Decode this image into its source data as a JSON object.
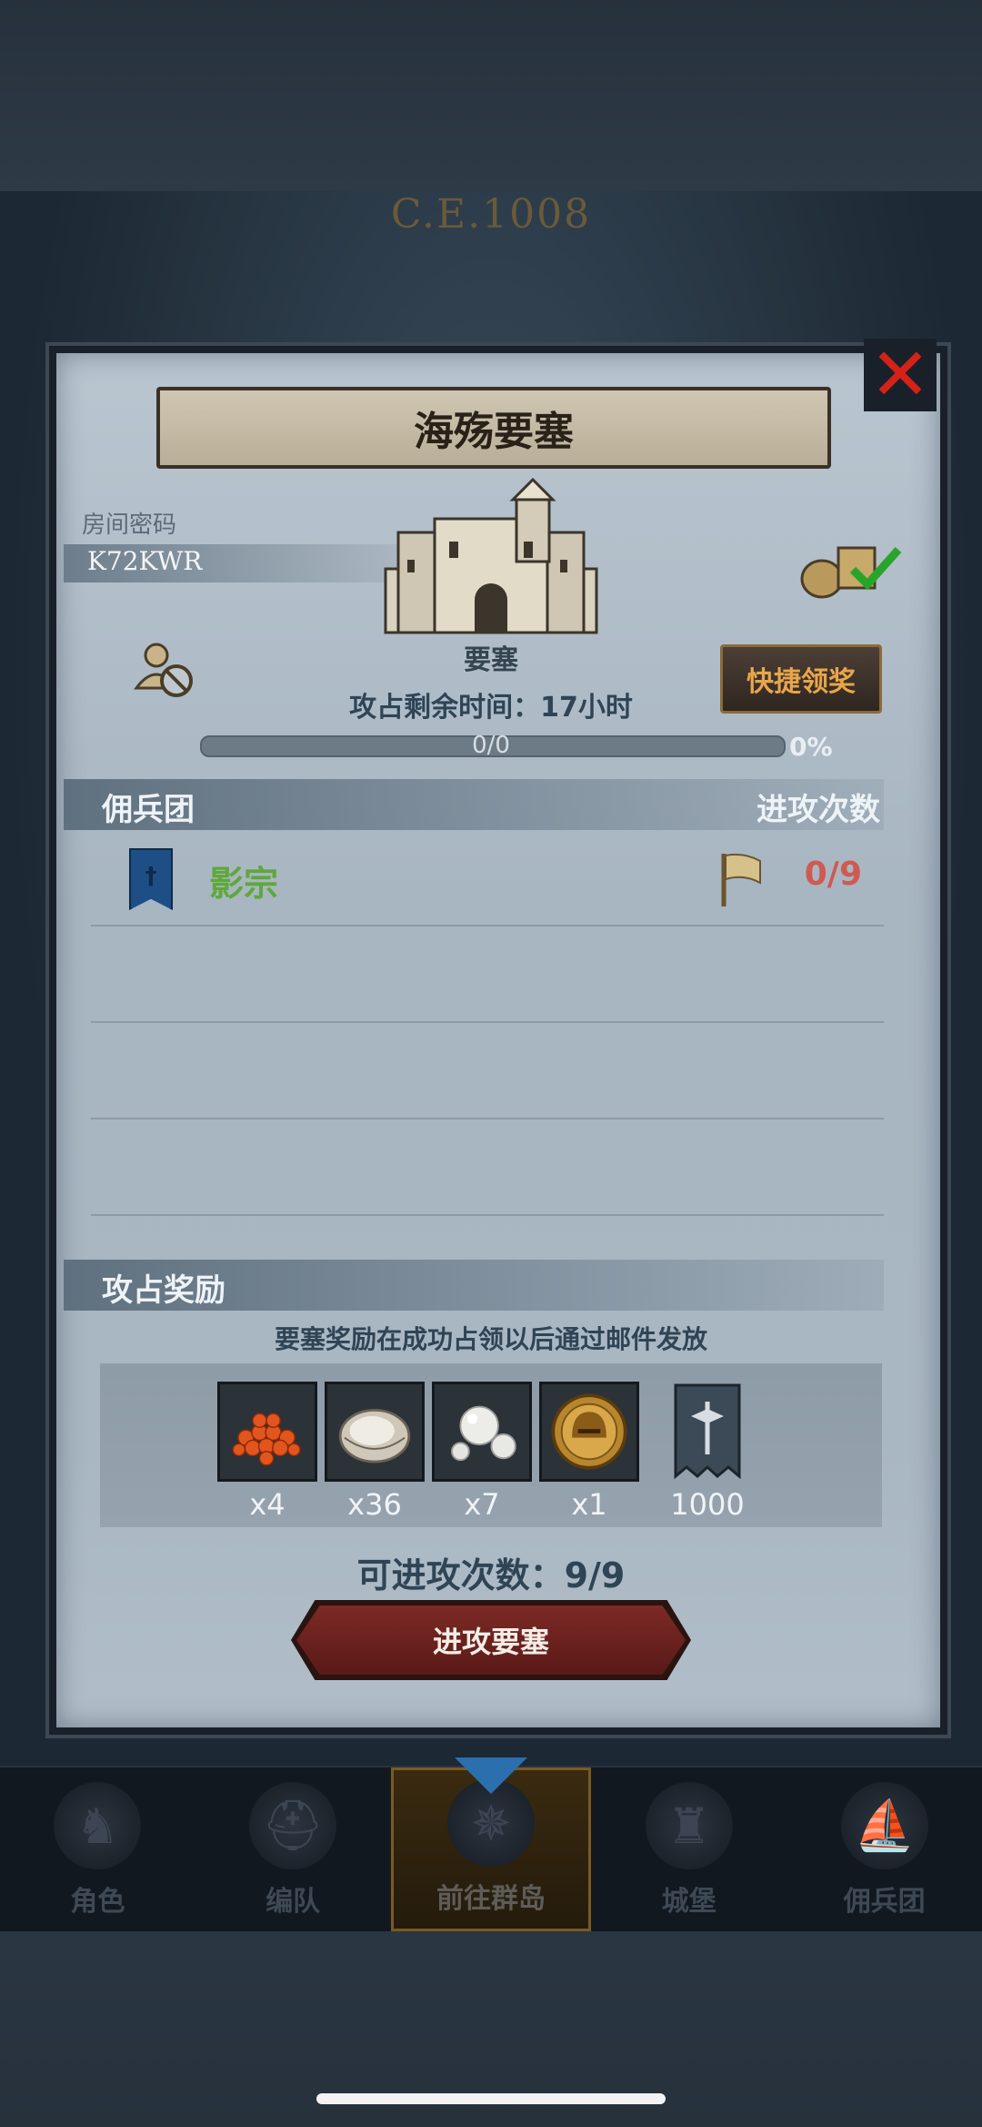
{
  "era": "C.E.1008",
  "dialog": {
    "title": "海殇要塞",
    "room_code_label": "房间密码",
    "room_code": "K72KWR",
    "fortress_label": "要塞",
    "quick_claim_label": "快捷领奖",
    "time_remaining": "攻占剩余时间：17小时",
    "progress_count": "0/0",
    "progress_percent": "0%",
    "progress_fraction": 0,
    "merc_header": "佣兵团",
    "attack_header": "进攻次数",
    "mercenaries": [
      {
        "name": "影宗",
        "attacks": "0/9"
      }
    ],
    "reward_header": "攻占奖励",
    "reward_note": "要塞奖励在成功占领以后通过邮件发放",
    "rewards": [
      {
        "icon": "roe-icon",
        "qty": "x4"
      },
      {
        "icon": "oyster-icon",
        "qty": "x36"
      },
      {
        "icon": "pearl-icon",
        "qty": "x7"
      },
      {
        "icon": "helmet-coin-icon",
        "qty": "x1"
      },
      {
        "icon": "war-banner-icon",
        "qty": "1000"
      }
    ],
    "attempts": "可进攻次数：9/9",
    "attack_button": "进攻要塞"
  },
  "nav": [
    {
      "label": "角色",
      "icon": "knight-icon"
    },
    {
      "label": "编队",
      "icon": "helmet-icon"
    },
    {
      "label": "前往群岛",
      "icon": "compass-icon",
      "active": true
    },
    {
      "label": "城堡",
      "icon": "castle-icon"
    },
    {
      "label": "佣兵团",
      "icon": "ship-icon"
    }
  ],
  "colors": {
    "accent_gold": "#e7a64a",
    "merc_green": "#5fa83a",
    "count_red": "#cf5a52",
    "close_red": "#d42218"
  }
}
